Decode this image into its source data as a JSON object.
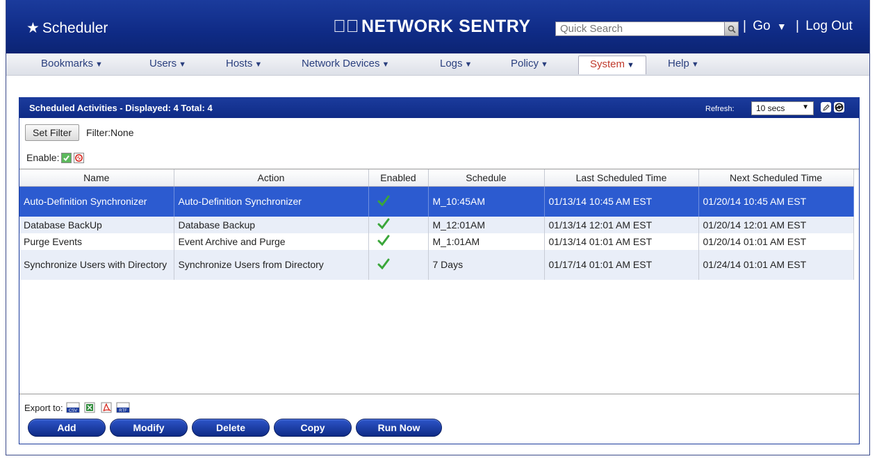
{
  "header": {
    "title": "Scheduler",
    "brand": "NETWORK SENTRY",
    "search_placeholder": "Quick Search",
    "go_label": "Go",
    "logout_label": "Log Out",
    "separator": "|"
  },
  "nav": {
    "items": [
      {
        "label": "Bookmarks"
      },
      {
        "label": "Users"
      },
      {
        "label": "Hosts"
      },
      {
        "label": "Network Devices"
      },
      {
        "label": "Logs"
      },
      {
        "label": "Policy"
      },
      {
        "label": "System",
        "active": true
      },
      {
        "label": "Help"
      }
    ]
  },
  "panel": {
    "title": "Scheduled Activities - Displayed: 4 Total: 4",
    "refresh_label": "Refresh:",
    "refresh_value": "10 secs",
    "set_filter_label": "Set Filter",
    "filter_text": "Filter:None",
    "enable_label": "Enable:"
  },
  "table": {
    "columns": [
      "Name",
      "Action",
      "Enabled",
      "Schedule",
      "Last Scheduled Time",
      "Next Scheduled Time"
    ],
    "rows": [
      {
        "name": "Auto-Definition Synchronizer",
        "action": "Auto-Definition Synchronizer",
        "enabled": true,
        "schedule": "M_10:45AM",
        "last": "01/13/14 10:45 AM EST",
        "next": "01/20/14 10:45 AM EST",
        "selected": true
      },
      {
        "name": "Database BackUp",
        "action": "Database Backup",
        "enabled": true,
        "schedule": "M_12:01AM",
        "last": "01/13/14 12:01 AM EST",
        "next": "01/20/14 12:01 AM EST"
      },
      {
        "name": "Purge Events",
        "action": "Event Archive and Purge",
        "enabled": true,
        "schedule": "M_1:01AM",
        "last": "01/13/14 01:01 AM EST",
        "next": "01/20/14 01:01 AM EST"
      },
      {
        "name": "Synchronize Users with Directory",
        "action": "Synchronize Users from Directory",
        "enabled": true,
        "schedule": "7 Days",
        "last": "01/17/14 01:01 AM EST",
        "next": "01/24/14 01:01 AM EST"
      }
    ]
  },
  "export": {
    "label": "Export to:",
    "formats": [
      "csv",
      "xls",
      "pdf",
      "rtf"
    ]
  },
  "actions": {
    "add": "Add",
    "modify": "Modify",
    "delete": "Delete",
    "copy": "Copy",
    "run_now": "Run Now"
  },
  "colors": {
    "header_blue": "#0f2b86",
    "selected_row": "#2c5bd0",
    "active_tab_text": "#c0392b",
    "check_green": "#3aa63a"
  }
}
